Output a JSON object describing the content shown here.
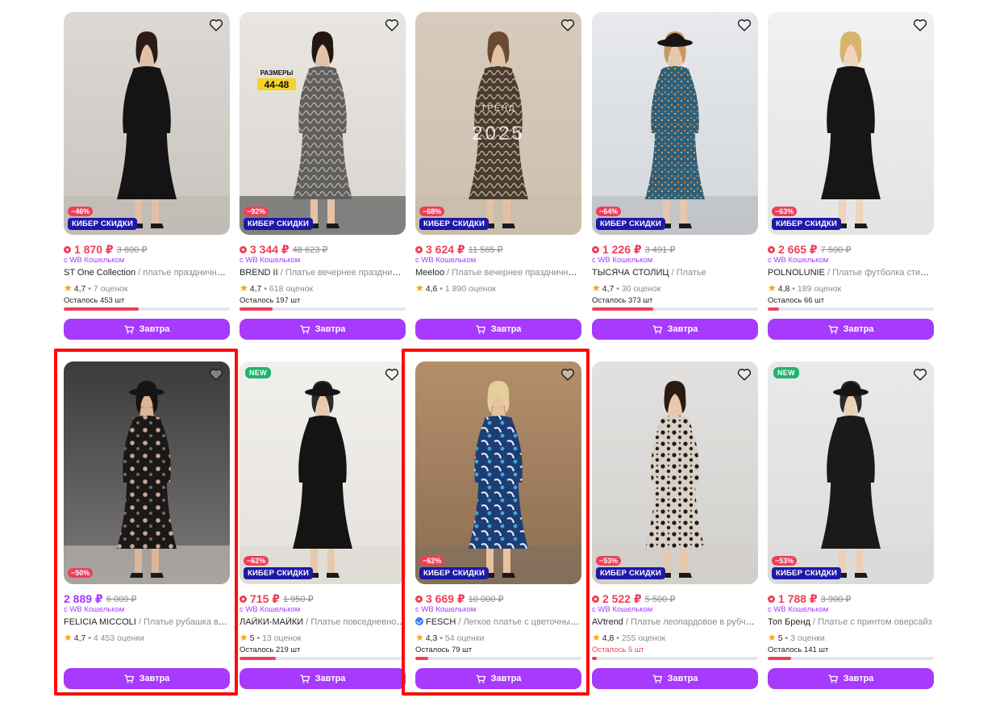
{
  "products": [
    {
      "discount": "−46%",
      "promo_badge": "КИБЕР СКИДКИ",
      "price": "1 870 ₽",
      "old_price": "3 600 ₽",
      "wallet_note": "с WB Кошельком",
      "brand": "ST One Collection",
      "description": " / платье праздничное …",
      "rating": "4,7",
      "reviews": " • 7 оценок",
      "stock_label": "Осталось 453 шт",
      "stock_fraction": 0.45,
      "button_label": "Завтра",
      "is_new": false,
      "verified": false,
      "wallet_icon": true,
      "price_color": "red"
    },
    {
      "discount": "−92%",
      "promo_badge": "КИБЕР СКИДКИ",
      "price": "3 344 ₽",
      "old_price": "48 623 ₽",
      "wallet_note": "с WB Кошельком",
      "brand": "BREND II",
      "description": " / Платье вечернее празднично…",
      "rating": "4,7",
      "reviews": " • 618 оценок",
      "stock_label": "Осталось 197 шт",
      "stock_fraction": 0.2,
      "button_label": "Завтра",
      "is_new": false,
      "verified": false,
      "wallet_icon": true,
      "price_color": "red",
      "image_caption_top": "РАЗМЕРЫ",
      "image_caption_size": "44-48"
    },
    {
      "discount": "−68%",
      "promo_badge": "КИБЕР СКИДКИ",
      "price": "3 624 ₽",
      "old_price": "11 565 ₽",
      "wallet_note": "с WB Кошельком",
      "brand": "Meeloo",
      "description": " / Платье вечернее праздничное …",
      "rating": "4,6",
      "reviews": " • 1 890 оценок",
      "stock_label": "",
      "stock_fraction": null,
      "button_label": "Завтра",
      "is_new": false,
      "verified": false,
      "wallet_icon": true,
      "price_color": "red",
      "image_caption_top": "ТРЕНД",
      "image_caption_year": "2025"
    },
    {
      "discount": "−64%",
      "promo_badge": "КИБЕР СКИДКИ",
      "price": "1 226 ₽",
      "old_price": "3 491 ₽",
      "wallet_note": "с WB Кошельком",
      "brand": "ТЫСЯЧА СТОЛИЦ",
      "description": " / Платье",
      "rating": "4,7",
      "reviews": " • 30 оценок",
      "stock_label": "Осталось 373 шт",
      "stock_fraction": 0.37,
      "button_label": "Завтра",
      "is_new": false,
      "verified": false,
      "wallet_icon": true,
      "price_color": "red"
    },
    {
      "discount": "−63%",
      "promo_badge": "КИБЕР СКИДКИ",
      "price": "2 665 ₽",
      "old_price": "7 500 ₽",
      "wallet_note": "с WB Кошельком",
      "brand": "POLNOLUNIE",
      "description": " / Платье футболка стильн…",
      "rating": "4,8",
      "reviews": " • 189 оценок",
      "stock_label": "Осталось 66 шт",
      "stock_fraction": 0.07,
      "button_label": "Завтра",
      "is_new": false,
      "verified": false,
      "wallet_icon": true,
      "price_color": "red"
    },
    {
      "discount": "−50%",
      "promo_badge": "",
      "price": "2 889 ₽",
      "old_price": "6 000 ₽",
      "wallet_note": "с WB Кошельком",
      "brand": "FELICIA MICCOLI",
      "description": " / Платье рубашка веч…",
      "rating": "4,7",
      "reviews": " • 4 453 оценки",
      "stock_label": "",
      "stock_fraction": null,
      "button_label": "Завтра",
      "is_new": false,
      "verified": false,
      "wallet_icon": false,
      "price_color": "violet",
      "highlighted": true
    },
    {
      "discount": "−62%",
      "promo_badge": "КИБЕР СКИДКИ",
      "price": "715 ₽",
      "old_price": "1 950 ₽",
      "wallet_note": "с WB Кошельком",
      "brand": "ЛАЙКИ-МАЙКИ",
      "description": " / Платье повседневное …",
      "rating": "5",
      "reviews": " • 13 оценок",
      "stock_label": "Осталось 219 шт",
      "stock_fraction": 0.22,
      "button_label": "Завтра",
      "is_new": true,
      "verified": false,
      "wallet_icon": true,
      "price_color": "red"
    },
    {
      "discount": "−62%",
      "promo_badge": "КИБЕР СКИДКИ",
      "price": "3 669 ₽",
      "old_price": "10 000 ₽",
      "wallet_note": "с WB Кошельком",
      "brand": "FESCH",
      "description": " / Легкое платье с цветочным п…",
      "rating": "4,3",
      "reviews": " • 54 оценки",
      "stock_label": "Осталось 79 шт",
      "stock_fraction": 0.08,
      "button_label": "Завтра",
      "is_new": false,
      "verified": true,
      "wallet_icon": true,
      "price_color": "red",
      "highlighted": true
    },
    {
      "discount": "−53%",
      "promo_badge": "КИБЕР СКИДКИ",
      "price": "2 522 ₽",
      "old_price": "5 500 ₽",
      "wallet_note": "с WB Кошельком",
      "brand": "AVtrend",
      "description": " / Платье леопардовое в рубчик …",
      "rating": "4,8",
      "reviews": " • 255 оценок",
      "stock_label": "Осталось 5 шт",
      "stock_fraction": 0.01,
      "stock_alert": true,
      "button_label": "Завтра",
      "is_new": false,
      "verified": false,
      "wallet_icon": true,
      "price_color": "red"
    },
    {
      "discount": "−53%",
      "promo_badge": "КИБЕР СКИДКИ",
      "price": "1 788 ₽",
      "old_price": "3 900 ₽",
      "wallet_note": "с WB Кошельком",
      "brand": "Топ Бренд",
      "description": " / Платье с принтом оверсайз",
      "rating": "5",
      "reviews": " • 3 оценки",
      "stock_label": "Осталось 141 шт",
      "stock_fraction": 0.14,
      "button_label": "Завтра",
      "is_new": true,
      "verified": false,
      "wallet_icon": true,
      "price_color": "red"
    }
  ],
  "labels": {
    "new_badge": "NEW"
  },
  "icons": {
    "favorite": "heart-outline-icon",
    "cart": "shopping-cart-icon",
    "rating": "star-icon",
    "wallet": "wb-wallet-icon",
    "verified": "verified-check-icon"
  },
  "colors": {
    "accent": "#a73afd",
    "sale": "#ee3f58",
    "promo": "#1e1aa8",
    "new": "#20b26b",
    "star": "#ff9d00",
    "highlight": "#ff0a0a"
  }
}
